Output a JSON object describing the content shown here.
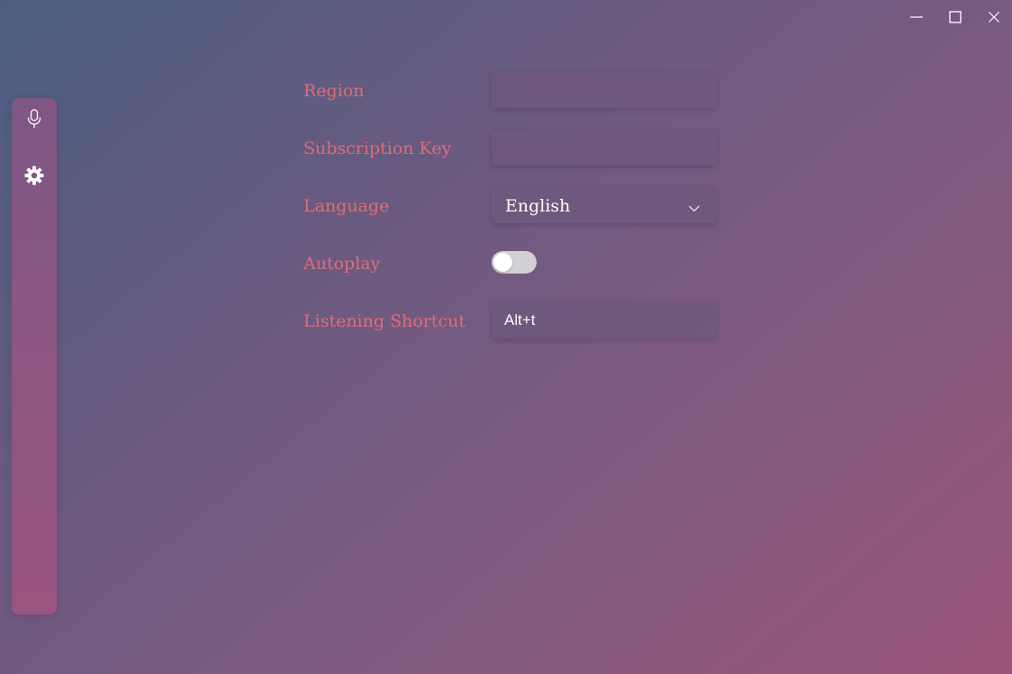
{
  "window_controls": {
    "minimize_icon": "minimize-icon",
    "maximize_icon": "maximize-icon",
    "close_icon": "close-icon"
  },
  "sidebar": {
    "items": [
      {
        "icon": "microphone-icon"
      },
      {
        "icon": "gear-icon"
      }
    ]
  },
  "settings": {
    "region": {
      "label": "Region",
      "value": ""
    },
    "subscription_key": {
      "label": "Subscription Key",
      "value": ""
    },
    "language": {
      "label": "Language",
      "value": "English"
    },
    "autoplay": {
      "label": "Autoplay",
      "enabled": false
    },
    "listening_shortcut": {
      "label": "Listening Shortcut",
      "value": "Alt+t"
    }
  },
  "colors": {
    "label": "#df6b78",
    "text": "#ffffff",
    "toggle_off": "#d2d0d4"
  }
}
